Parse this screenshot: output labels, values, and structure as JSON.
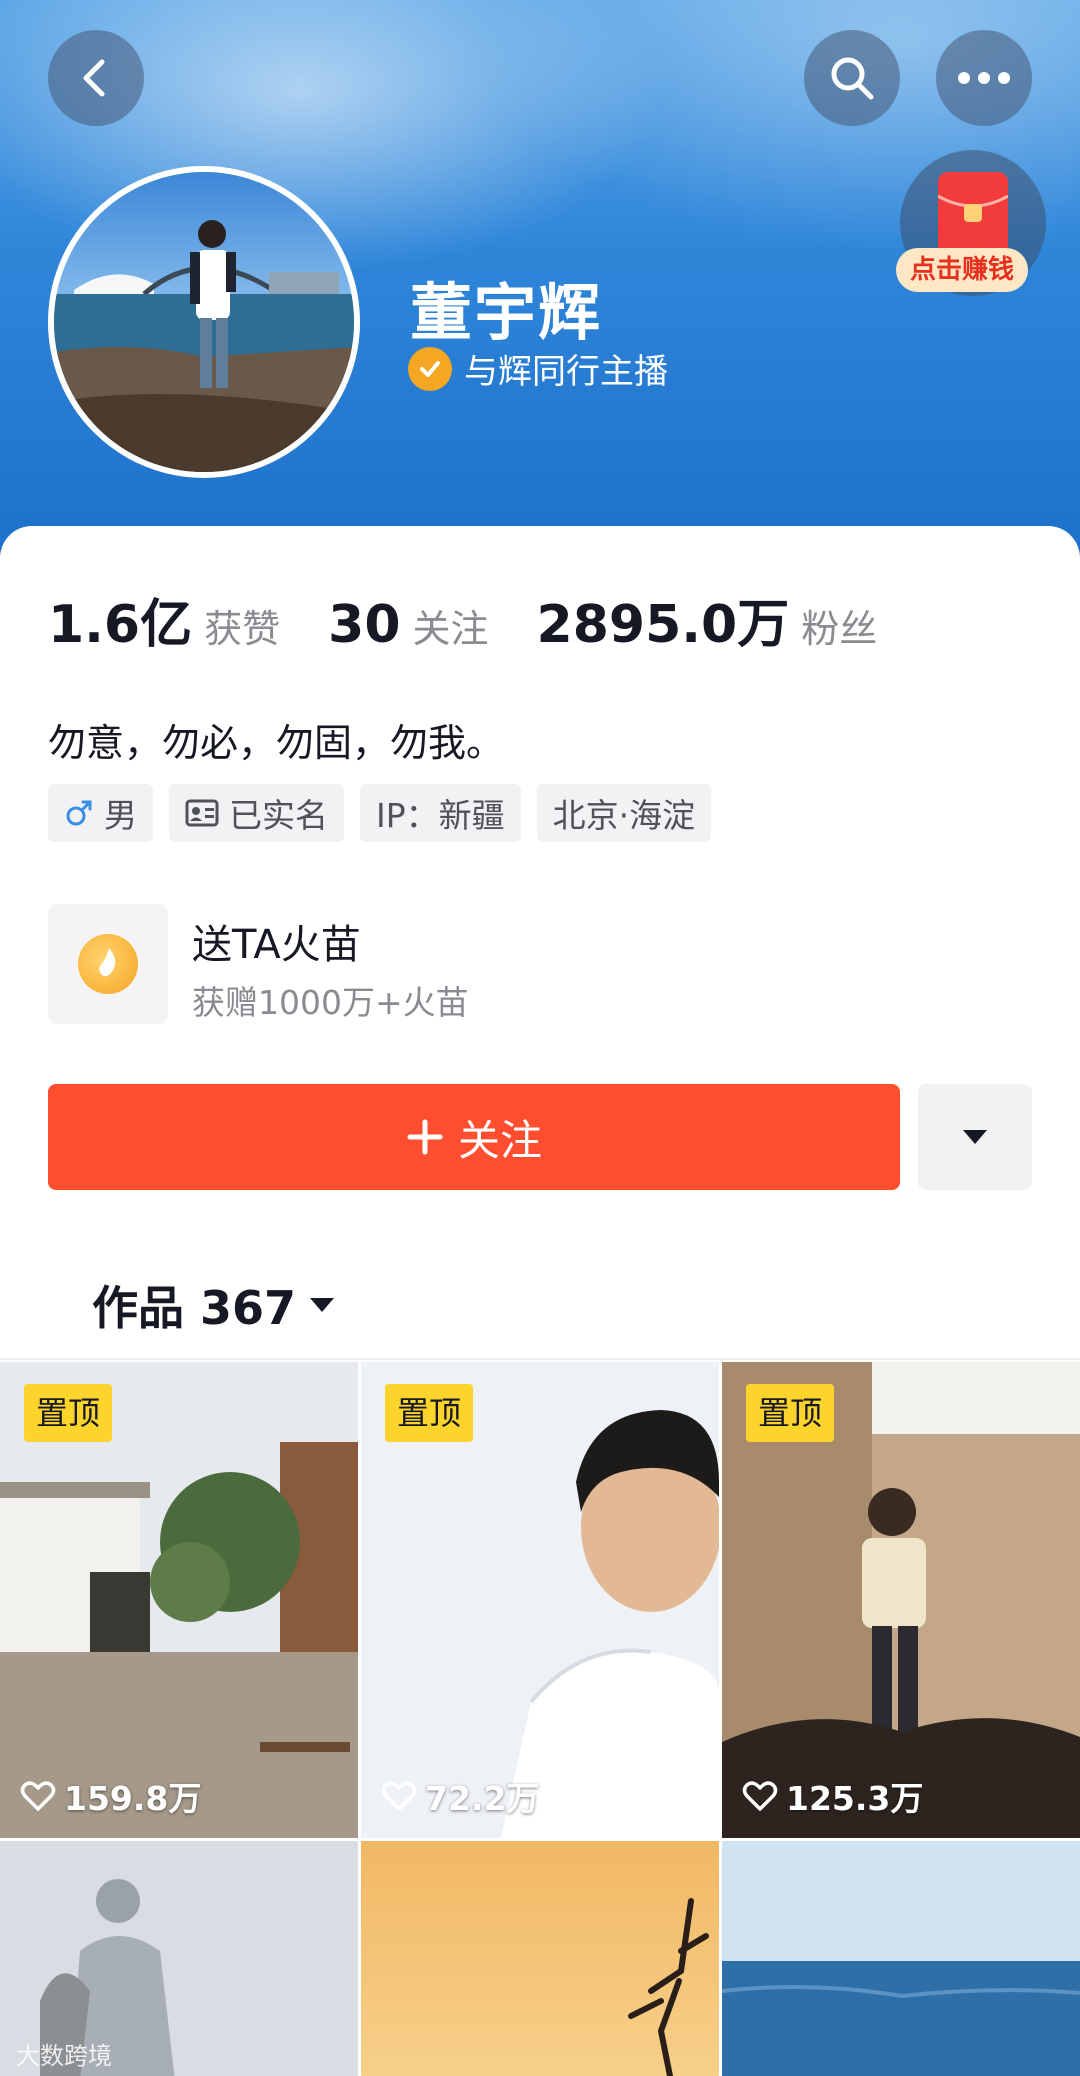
{
  "profile": {
    "name": "董宇辉",
    "verified_text": "与辉同行主播",
    "bio": "勿意，勿必，勿固，勿我。"
  },
  "stats": [
    {
      "value": "1.6亿",
      "label": "获赞"
    },
    {
      "value": "30",
      "label": "关注"
    },
    {
      "value": "2895.0万",
      "label": "粉丝"
    }
  ],
  "tags": [
    {
      "text": "男",
      "icon": "male-icon"
    },
    {
      "text": "已实名",
      "icon": "id-card-icon"
    },
    {
      "text": "IP：新疆",
      "icon": ""
    },
    {
      "text": "北京·海淀",
      "icon": ""
    }
  ],
  "redpacket": {
    "label": "点击赚钱"
  },
  "gift": {
    "title": "送TA火苗",
    "subtitle": "获赠1000万+火苗"
  },
  "actions": {
    "follow_label": "关注"
  },
  "works": {
    "tab_label": "作品 367"
  },
  "videos": [
    {
      "pinned": true,
      "pin_label": "置顶",
      "likes": "159.8万"
    },
    {
      "pinned": true,
      "pin_label": "置顶",
      "likes": "72.2万"
    },
    {
      "pinned": true,
      "pin_label": "置顶",
      "likes": "125.3万"
    },
    {
      "pinned": false,
      "pin_label": "",
      "likes": ""
    },
    {
      "pinned": false,
      "pin_label": "",
      "likes": ""
    },
    {
      "pinned": false,
      "pin_label": "",
      "likes": ""
    }
  ],
  "watermark": "大数跨境",
  "colors": {
    "follow": "#fe4d2f",
    "pin": "#fcd42c",
    "header": "#2f86d9"
  }
}
